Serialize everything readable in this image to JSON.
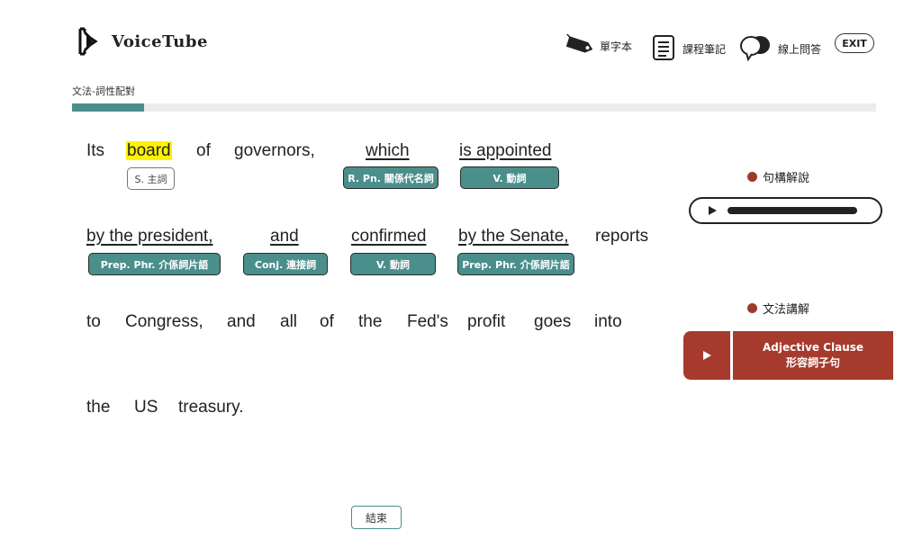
{
  "header": {
    "logo_text": "VoiceTube",
    "nav": {
      "vocabulary": "單字本",
      "notes": "課程筆記",
      "qa": "線上問答",
      "exit": "EXIT"
    }
  },
  "lesson": {
    "section_title": "文法-詞性配對",
    "progress_fraction": 0.09
  },
  "sentence": {
    "line1": {
      "its": "Its",
      "board": "board",
      "of": "of",
      "governors": "governors,",
      "which": "which",
      "is_appointed": "is appointed"
    },
    "line1_tags": {
      "subject": "S. 主詞",
      "relative_pronoun": "R. Pn. 關係代名詞",
      "verb": "V. 動詞"
    },
    "line2": {
      "by_president": "by the president,",
      "and": "and",
      "confirmed": "confirmed",
      "by_senate": "by the Senate,",
      "reports": "reports"
    },
    "line2_tags": {
      "prep1": "Prep. Phr. 介係詞片語",
      "conj": "Conj. 連接詞",
      "verb": "V. 動詞",
      "prep2": "Prep. Phr. 介係詞片語"
    },
    "line3": [
      "to",
      "Congress,",
      "and",
      "all",
      "of",
      "the",
      "Fed's",
      "profit",
      "goes",
      "into"
    ],
    "line4": [
      "the",
      "US",
      "treasury."
    ]
  },
  "side": {
    "structure_title": "句構解說",
    "grammar_title": "文法講解",
    "grammar_en": "Adjective Clause",
    "grammar_zh": "形容詞子句"
  },
  "footer": {
    "end_label": "結束"
  },
  "colors": {
    "accent": "#4a8f8c",
    "highlight": "#fff200",
    "brand_red": "#a63a2d"
  }
}
